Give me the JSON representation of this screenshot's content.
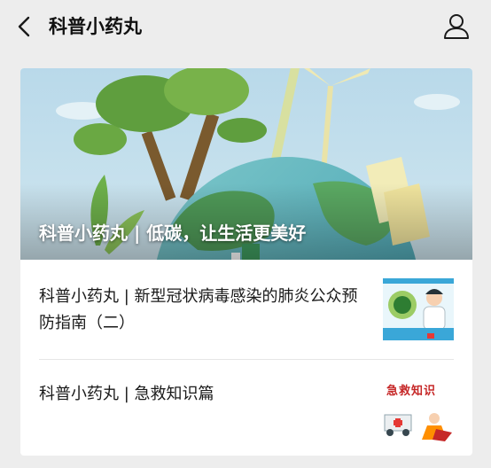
{
  "navbar": {
    "title": "科普小药丸",
    "back_icon": "chevron-left-icon",
    "profile_icon": "user-icon"
  },
  "cover_article": {
    "title": "科普小药丸 | 低碳，让生活更美好"
  },
  "articles": [
    {
      "title": "科普小药丸 | 新型冠状病毒感染的肺炎公众预防指南（二）",
      "thumbnail": "doctor-virus-illustration"
    },
    {
      "title": "科普小药丸 | 急救知识篇",
      "thumbnail": "first-aid-illustration",
      "thumbnail_text": "急救知识"
    }
  ],
  "colors": {
    "background": "#ededed",
    "card": "#ffffff",
    "text": "#1a1a1a"
  }
}
